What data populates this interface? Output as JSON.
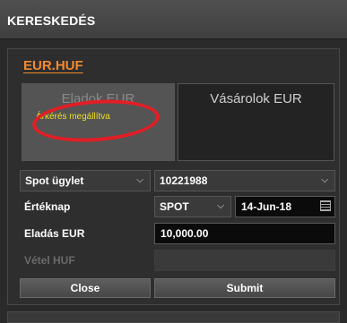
{
  "panel": {
    "title": "KERESKEDÉS"
  },
  "instrument": {
    "symbol": "EUR.HUF"
  },
  "tiles": {
    "sell": {
      "label": "Eladok EUR",
      "status": "Árkérés megállítva"
    },
    "buy": {
      "label": "Vásárolok EUR"
    }
  },
  "form": {
    "deal_type": "Spot ügylet",
    "account": "10221988",
    "value_date_label": "Értéknap",
    "value_date_type": "SPOT",
    "value_date": "14-Jun-18",
    "sell_label": "Eladás EUR",
    "sell_amount": "10,000.00",
    "buy_label": "Vétel HUF",
    "buy_amount": ""
  },
  "buttons": {
    "close": "Close",
    "submit": "Submit"
  },
  "colors": {
    "accent": "#f28a2e",
    "status": "#f0e020",
    "annotation": "#e21e26"
  },
  "icons": {
    "dropdown": "chevron-down-icon",
    "calendar": "calendar-icon"
  }
}
